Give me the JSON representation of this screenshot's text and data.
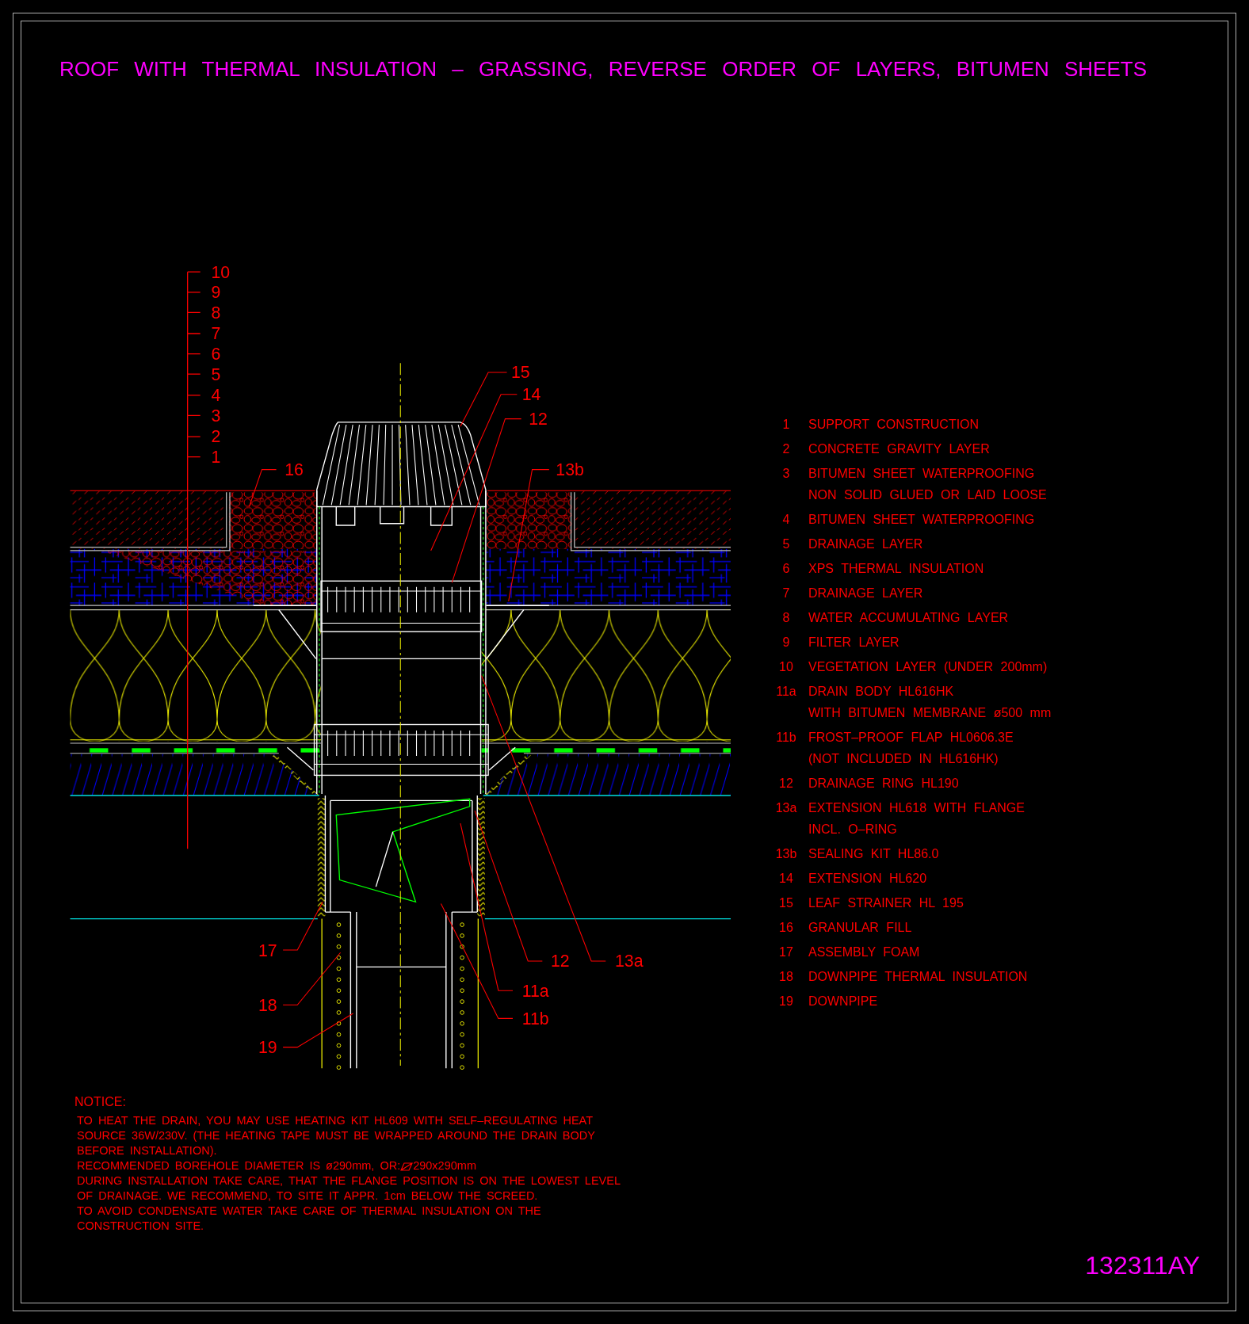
{
  "title": "ROOF WITH THERMAL INSULATION – GRASSING, REVERSE ORDER OF LAYERS, BITUMEN SHEETS",
  "drawing": {
    "scale_labels": [
      "10",
      "9",
      "8",
      "7",
      "6",
      "5",
      "4",
      "3",
      "2",
      "1"
    ],
    "callouts": [
      "15",
      "14",
      "12",
      "13b",
      "16",
      "17",
      "18",
      "19",
      "12",
      "13a",
      "11a",
      "11b"
    ]
  },
  "legend": [
    {
      "number": "1",
      "lines": [
        "SUPPORT CONSTRUCTION"
      ]
    },
    {
      "number": "2",
      "lines": [
        "CONCRETE GRAVITY LAYER"
      ]
    },
    {
      "number": "3",
      "lines": [
        "BITUMEN SHEET WATERPROOFING",
        "NON SOLID GLUED OR LAID LOOSE"
      ]
    },
    {
      "number": "4",
      "lines": [
        "BITUMEN SHEET WATERPROOFING"
      ]
    },
    {
      "number": "5",
      "lines": [
        "DRAINAGE LAYER"
      ]
    },
    {
      "number": "6",
      "lines": [
        "XPS THERMAL INSULATION"
      ]
    },
    {
      "number": "7",
      "lines": [
        "DRAINAGE LAYER"
      ]
    },
    {
      "number": "8",
      "lines": [
        "WATER ACCUMULATING LAYER"
      ]
    },
    {
      "number": "9",
      "lines": [
        "FILTER LAYER"
      ]
    },
    {
      "number": "10",
      "lines": [
        "VEGETATION LAYER (UNDER 200mm)"
      ]
    },
    {
      "number": "11a",
      "lines": [
        "DRAIN BODY HL616HK",
        "WITH BITUMEN MEMBRANE ø500 mm"
      ]
    },
    {
      "number": "11b",
      "lines": [
        "FROST–PROOF FLAP HL0606.3E",
        "(NOT INCLUDED IN HL616HK)"
      ]
    },
    {
      "number": "12",
      "lines": [
        "DRAINAGE RING HL190"
      ]
    },
    {
      "number": "13a",
      "lines": [
        "EXTENSION HL618 WITH FLANGE",
        "INCL. O–RING"
      ]
    },
    {
      "number": "13b",
      "lines": [
        "SEALING KIT HL86.0"
      ]
    },
    {
      "number": "14",
      "lines": [
        "EXTENSION HL620"
      ]
    },
    {
      "number": "15",
      "lines": [
        "LEAF STRAINER HL 195"
      ]
    },
    {
      "number": "16",
      "lines": [
        "GRANULAR FILL"
      ]
    },
    {
      "number": "17",
      "lines": [
        "ASSEMBLY FOAM"
      ]
    },
    {
      "number": "18",
      "lines": [
        "DOWNPIPE THERMAL INSULATION"
      ]
    },
    {
      "number": "19",
      "lines": [
        "DOWNPIPE"
      ]
    }
  ],
  "notice": {
    "heading": "NOTICE:",
    "lines": [
      {
        "text": "TO HEAT THE DRAIN, YOU MAY USE HEATING KIT HL609 WITH SELF–REGULATING HEAT"
      },
      {
        "text": "SOURCE 36W/230V. (THE HEATING TAPE MUST BE WRAPPED AROUND THE DRAIN BODY"
      },
      {
        "text": "BEFORE INSTALLATION)."
      },
      {
        "text": "RECOMMENDED BOREHOLE DIAMETER IS ø290mm, OR:",
        "after_icon": "290x290mm"
      },
      {
        "text": "DURING INSTALLATION TAKE CARE, THAT THE FLANGE POSITION IS ON THE LOWEST LEVEL"
      },
      {
        "text": "OF DRAINAGE. WE RECOMMEND, TO SITE IT APPR. 1cm BELOW THE SCREED."
      },
      {
        "text": "TO AVOID CONDENSATE WATER TAKE CARE OF THERMAL INSULATION ON THE"
      },
      {
        "text": "CONSTRUCTION SITE."
      }
    ]
  },
  "drawing_number": "132311AY"
}
